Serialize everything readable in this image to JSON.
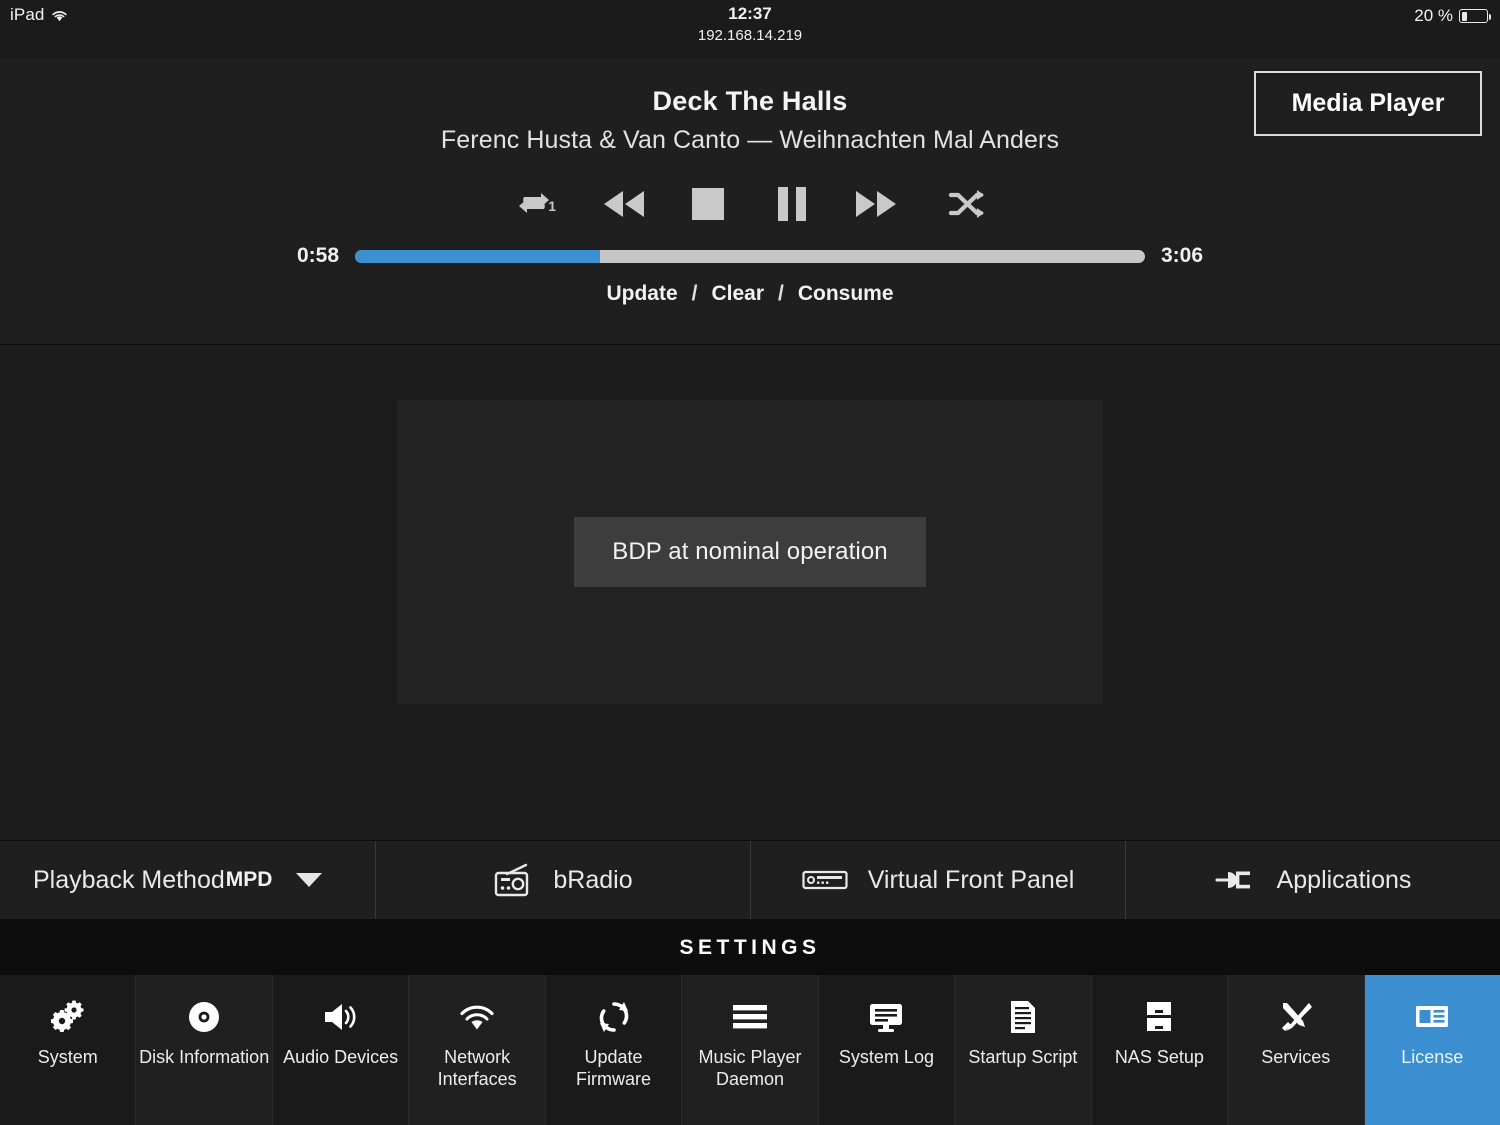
{
  "status_bar": {
    "device": "iPad",
    "wifi_icon": "wifi-icon",
    "time": "12:37",
    "ip_address": "192.168.14.219",
    "battery_percent": "20 %",
    "battery_level": 20
  },
  "player": {
    "track_title": "Deck The Halls",
    "track_subtitle": "Ferenc Husta & Van Canto — Weihnachten Mal Anders",
    "media_badge": "Media Player",
    "controls": [
      {
        "name": "repeat-one-icon",
        "label": "Repeat One",
        "badge": "1"
      },
      {
        "name": "rewind-icon",
        "label": "Rewind"
      },
      {
        "name": "stop-icon",
        "label": "Stop"
      },
      {
        "name": "pause-icon",
        "label": "Pause"
      },
      {
        "name": "fast-forward-icon",
        "label": "Fast Forward"
      },
      {
        "name": "shuffle-icon",
        "label": "Shuffle"
      }
    ],
    "elapsed": "0:58",
    "duration": "3:06",
    "progress_percent": 31,
    "progress_color": "#3b90d2",
    "links": {
      "update": "Update",
      "clear": "Clear",
      "consume": "Consume",
      "separator": "/"
    }
  },
  "main": {
    "toast_message": "BDP at nominal operation"
  },
  "navbar": {
    "playback_method": {
      "label": "Playback Method",
      "value": "MPD",
      "caret_icon": "chevron-down-icon"
    },
    "items": [
      {
        "label": "bRadio",
        "icon": "radio-icon"
      },
      {
        "label": "Virtual Front Panel",
        "icon": "front-panel-icon"
      },
      {
        "label": "Applications",
        "icon": "plug-icon"
      }
    ]
  },
  "settings": {
    "title": "SETTINGS",
    "active_color": "#3b8fd0",
    "items": [
      {
        "label": "System",
        "icon": "gears-icon",
        "active": false
      },
      {
        "label": "Disk Information",
        "icon": "disc-icon",
        "active": false
      },
      {
        "label": "Audio Devices",
        "icon": "speaker-icon",
        "active": false
      },
      {
        "label": "Network Interfaces",
        "icon": "wifi-icon",
        "active": false
      },
      {
        "label": "Update Firmware",
        "icon": "refresh-icon",
        "active": false
      },
      {
        "label": "Music Player Daemon",
        "icon": "stack-lines-icon",
        "active": false
      },
      {
        "label": "System Log",
        "icon": "monitor-icon",
        "active": false
      },
      {
        "label": "Startup Script",
        "icon": "document-icon",
        "active": false
      },
      {
        "label": "NAS Setup",
        "icon": "file-cabinet-icon",
        "active": false
      },
      {
        "label": "Services",
        "icon": "tools-icon",
        "active": false
      },
      {
        "label": "License",
        "icon": "id-card-icon",
        "active": true
      }
    ]
  }
}
